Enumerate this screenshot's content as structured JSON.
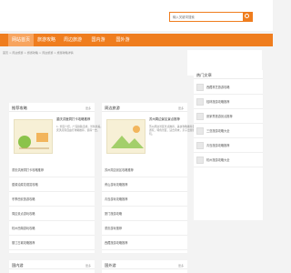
{
  "search": {
    "placeholder": "输入关键词搜索"
  },
  "nav": {
    "items": [
      "网站首页",
      "旅游攻略",
      "周边旅游",
      "国内游",
      "国外游"
    ]
  },
  "breadcrumb": "首页 > 周边旅游 > 旅游攻略 > 周边旅游 > 旅游攻略详情",
  "panels": {
    "guide": {
      "title": "推荐攻略",
      "more": "更多"
    },
    "nearby": {
      "title": "周边旅游",
      "more": "更多"
    },
    "hot": {
      "title": "热门文章"
    },
    "domestic": {
      "title": "国内游",
      "more": "更多"
    },
    "abroad": {
      "title": "国外游",
      "more": "更多"
    }
  },
  "feature_left": {
    "title": "重庆洪崖洞打卡攻略推荐",
    "desc": "1. 景区介绍，广深铁路沿线，景色优美，重庆洪崖洞自由行攻略推荐，值得一去。"
  },
  "feature_mid": {
    "title": "苏州周边景区景点推荐",
    "desc": "苏州周边景区景点推荐，美食攻略推荐自驾游玩，特色景区，适合周末，亲子出游游玩。"
  },
  "list_left": [
    "重庆洪崖洞打卡攻略推荐",
    "婺源油菜花观赏攻略",
    "冬季西安旅游攻略",
    "周边景点游玩攻略",
    "杭州西湖游玩攻略",
    "丽江古城攻略推荐"
  ],
  "list_mid": [
    "苏州周边景区攻略推荐",
    "黄山游玩攻略推荐",
    "青岛游玩攻略推荐",
    "厦门旅游攻略",
    "重庆游玩推荐",
    "西藏旅游攻略推荐"
  ],
  "hot_list": [
    "西藏林芝旅游攻略",
    "桂林旅游攻略推荐",
    "张家界旅游景点推荐",
    "三亚旅游攻略大全",
    "青岛旅游攻略推荐",
    "杭州旅游攻略大全"
  ]
}
